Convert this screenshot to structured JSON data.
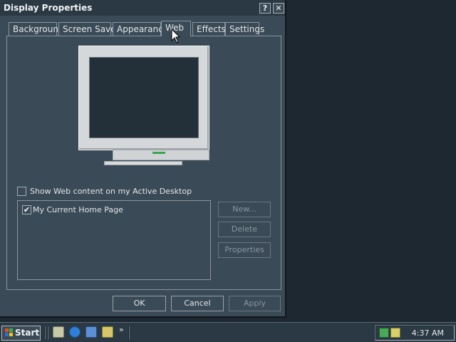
{
  "window": {
    "title": "Display Properties",
    "help_label": "?",
    "close_label": "✕"
  },
  "tabs": [
    {
      "label": "Background"
    },
    {
      "label": "Screen Saver"
    },
    {
      "label": "Appearance"
    },
    {
      "label": "Web",
      "active": true
    },
    {
      "label": "Effects"
    },
    {
      "label": "Settings"
    }
  ],
  "web": {
    "show_web_content_label": "Show Web content on my Active Desktop",
    "show_web_content_checked": false,
    "items": [
      {
        "label": "My Current Home Page",
        "checked": true
      }
    ],
    "new_label": "New...",
    "delete_label": "Delete",
    "properties_label": "Properties"
  },
  "buttons": {
    "ok": "OK",
    "cancel": "Cancel",
    "apply": "Apply"
  },
  "taskbar": {
    "start_label": "Start",
    "chevron": "»",
    "clock": "4:37 AM",
    "quick_launch": [
      "show-desktop-icon",
      "internet-explorer-icon",
      "outlook-express-icon",
      "windows-media-icon"
    ],
    "tray_icons": [
      "network-icon",
      "volume-icon"
    ]
  },
  "colors": {
    "background": "#1e2831",
    "dialog": "#3a4a56",
    "titlebar": "#2b3944",
    "accent_green": "#3aa64a"
  }
}
